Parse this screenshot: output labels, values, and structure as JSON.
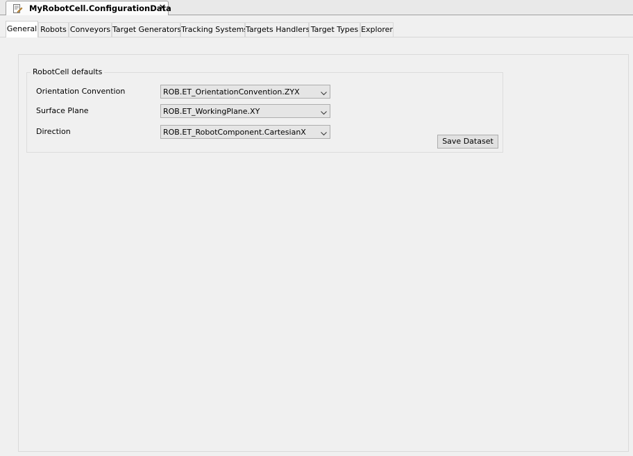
{
  "document_tab": {
    "title": "MyRobotCell.ConfigurationData",
    "icon": "configuration-document-icon",
    "close_symbol": "✕"
  },
  "tabs": [
    {
      "label": "General",
      "active": true
    },
    {
      "label": "Robots",
      "active": false
    },
    {
      "label": "Conveyors",
      "active": false
    },
    {
      "label": "Target Generators",
      "active": false
    },
    {
      "label": "Tracking Systems",
      "active": false
    },
    {
      "label": "Targets Handlers",
      "active": false
    },
    {
      "label": "Target Types",
      "active": false
    },
    {
      "label": "Explorer",
      "active": false
    }
  ],
  "group": {
    "title": "RobotCell defaults",
    "fields": [
      {
        "label": "Orientation Convention",
        "value": "ROB.ET_OrientationConvention.ZYX"
      },
      {
        "label": "Surface Plane",
        "value": "ROB.ET_WorkingPlane.XY"
      },
      {
        "label": "Direction",
        "value": "ROB.ET_RobotComponent.CartesianX"
      }
    ]
  },
  "buttons": {
    "save_label": "Save Dataset"
  }
}
